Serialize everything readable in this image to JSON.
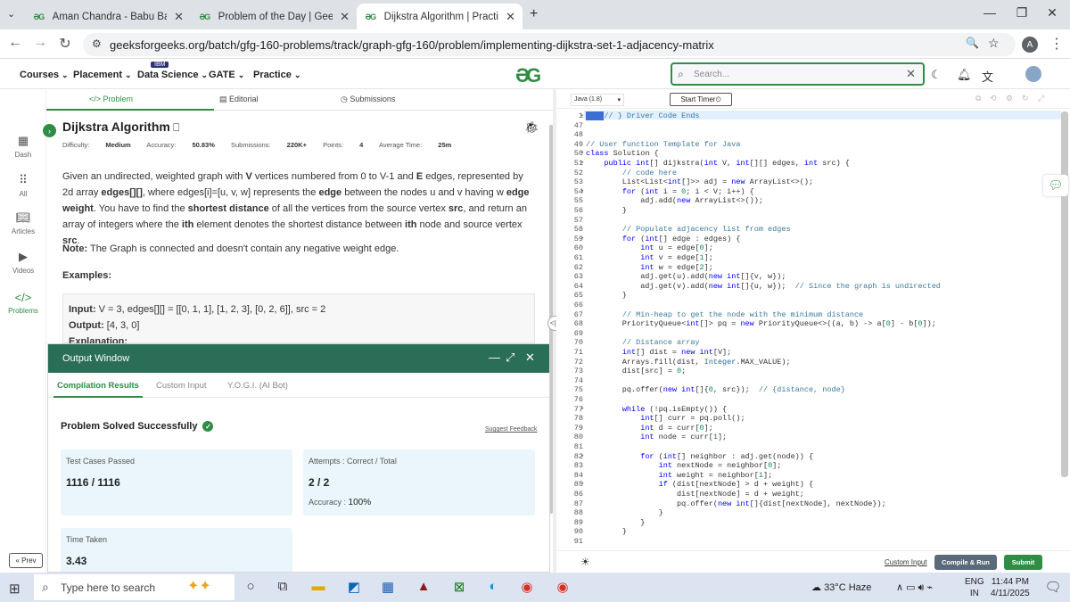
{
  "browser": {
    "tabs": [
      {
        "label": "Aman Chandra - Babu Banarasi"
      },
      {
        "label": "Problem of the Day | GeeksforG"
      },
      {
        "label": "Dijkstra Algorithm | Practice | G"
      }
    ],
    "url": "geeksforgeeks.org/batch/gfg-160-problems/track/graph-gfg-160/problem/implementing-dijkstra-set-1-adjacency-matrix",
    "profile_initial": "A"
  },
  "header": {
    "menus": [
      "Courses",
      "Placement",
      "Data Science",
      "GATE",
      "Practice"
    ],
    "ibm_badge": "IBM",
    "search_placeholder": "Search..."
  },
  "rail": {
    "items": [
      "Dash",
      "All",
      "Articles",
      "Videos",
      "Problems"
    ],
    "prev_label": "« Prev"
  },
  "problem": {
    "tabs": [
      "Problem",
      "Editorial",
      "Submissions"
    ],
    "title": "Dijkstra Algorithm",
    "meta": {
      "difficulty_label": "Difficulty:",
      "difficulty": "Medium",
      "accuracy_label": "Accuracy:",
      "accuracy": "50.83%",
      "submissions_label": "Submissions:",
      "submissions": "220K+",
      "points_label": "Points:",
      "points": "4",
      "avg_time_label": "Average Time:",
      "avg_time": "25m"
    },
    "note_label": "Note:",
    "note": "The Graph is connected and doesn't contain any negative weight edge.",
    "examples_label": "Examples:",
    "example": {
      "input_label": "Input:",
      "input": "V = 3, edges[][] = [[0, 1, 1], [1, 2, 3], [0, 2, 6]], src = 2",
      "output_label": "Output:",
      "output": "[4, 3, 0]",
      "explanation_label": "Explanation:"
    }
  },
  "output_window": {
    "title": "Output Window",
    "tabs": [
      "Compilation Results",
      "Custom Input",
      "Y.O.G.I. (AI Bot)"
    ],
    "status": "Problem Solved Successfully",
    "feedback": "Suggest Feedback",
    "test_cases_label": "Test Cases Passed",
    "test_cases": "1116 / 1116",
    "attempts_label": "Attempts : Correct / Total",
    "attempts": "2 / 2",
    "accuracy_label": "Accuracy :",
    "accuracy": "100%",
    "time_label": "Time Taken",
    "time": "3.43"
  },
  "editor": {
    "language": "Java (1.8)",
    "timer": "Start Timer",
    "custom_input": "Custom Input",
    "compile_run": "Compile & Run",
    "submit": "Submit"
  },
  "taskbar": {
    "search_placeholder": "Type here to search",
    "weather": "33°C  Haze",
    "lang_top": "ENG",
    "lang_bottom": "IN",
    "time": "11:44 PM",
    "date": "4/11/2025"
  }
}
